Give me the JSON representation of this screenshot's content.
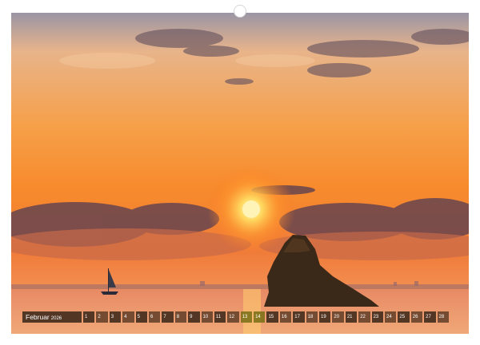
{
  "calendar": {
    "month": "Februar",
    "year": "2026",
    "days": [
      "1",
      "2",
      "3",
      "4",
      "5",
      "6",
      "7",
      "8",
      "9",
      "10",
      "11",
      "12",
      "13",
      "14",
      "15",
      "16",
      "17",
      "18",
      "19",
      "20",
      "21",
      "22",
      "23",
      "24",
      "25",
      "26",
      "27",
      "28"
    ]
  },
  "colors": {
    "sky_top": "#8a8a9a",
    "sky_orange": "#f59a3c",
    "sun": "#fff2a8",
    "rock": "#3a2818",
    "water": "#f0a066"
  },
  "icons": {
    "sailboat": "sailboat-icon"
  }
}
